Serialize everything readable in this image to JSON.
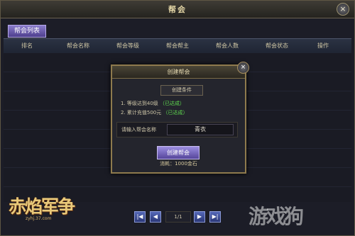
{
  "window": {
    "title": "帮会",
    "close_glyph": "×"
  },
  "tabs": [
    {
      "label": "帮会列表"
    }
  ],
  "columns": [
    {
      "label": "排名"
    },
    {
      "label": "帮会名称"
    },
    {
      "label": "帮会等级"
    },
    {
      "label": "帮会帮主"
    },
    {
      "label": "帮会人数"
    },
    {
      "label": "帮会状态"
    },
    {
      "label": "操作"
    }
  ],
  "modal": {
    "title": "创建帮会",
    "close_glyph": "×",
    "conditions_header": "创建条件",
    "conditions": [
      {
        "text": "1. 等级达到40级",
        "status": "（已达成）"
      },
      {
        "text": "2. 累计充值500元",
        "status": "（已达成）"
      }
    ],
    "input_label": "请输入帮会名称",
    "input_value": "青衣",
    "create_button": "创建帮会",
    "cost": "消耗：1000金石"
  },
  "pager": {
    "first": "|◀",
    "prev": "◀",
    "page": "1/1",
    "next": "▶",
    "last": "▶|"
  },
  "logo": {
    "text": "赤焰军争",
    "sub": "zyhj.37.com"
  },
  "watermark": "游戏狗"
}
